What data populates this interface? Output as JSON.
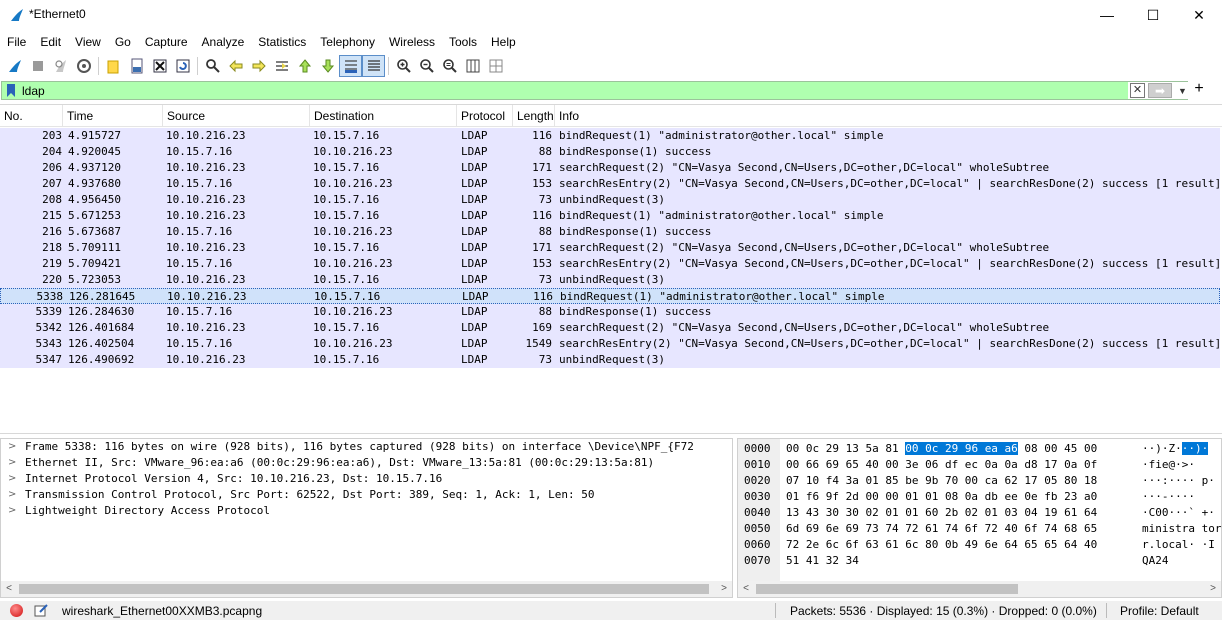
{
  "window": {
    "title": "*Ethernet0",
    "minimize": "—",
    "maximize": "☐",
    "close": "✕"
  },
  "menu": [
    "File",
    "Edit",
    "View",
    "Go",
    "Capture",
    "Analyze",
    "Statistics",
    "Telephony",
    "Wireless",
    "Tools",
    "Help"
  ],
  "filter": {
    "value": "ldap",
    "clear": "✕",
    "apply": "➡",
    "dropdown": "▼",
    "add": "+"
  },
  "columns": [
    "No.",
    "Time",
    "Source",
    "Destination",
    "Protocol",
    "Length",
    "Info"
  ],
  "packets": [
    {
      "no": "203",
      "time": "4.915727",
      "src": "10.10.216.23",
      "dst": "10.15.7.16",
      "proto": "LDAP",
      "len": "116",
      "info": "bindRequest(1) \"administrator@other.local\" simple"
    },
    {
      "no": "204",
      "time": "4.920045",
      "src": "10.15.7.16",
      "dst": "10.10.216.23",
      "proto": "LDAP",
      "len": "88",
      "info": "bindResponse(1) success"
    },
    {
      "no": "206",
      "time": "4.937120",
      "src": "10.10.216.23",
      "dst": "10.15.7.16",
      "proto": "LDAP",
      "len": "171",
      "info": "searchRequest(2) \"CN=Vasya Second,CN=Users,DC=other,DC=local\" wholeSubtree"
    },
    {
      "no": "207",
      "time": "4.937680",
      "src": "10.15.7.16",
      "dst": "10.10.216.23",
      "proto": "LDAP",
      "len": "153",
      "info": "searchResEntry(2) \"CN=Vasya Second,CN=Users,DC=other,DC=local\"  | searchResDone(2) success  [1 result]"
    },
    {
      "no": "208",
      "time": "4.956450",
      "src": "10.10.216.23",
      "dst": "10.15.7.16",
      "proto": "LDAP",
      "len": "73",
      "info": "unbindRequest(3)"
    },
    {
      "no": "215",
      "time": "5.671253",
      "src": "10.10.216.23",
      "dst": "10.15.7.16",
      "proto": "LDAP",
      "len": "116",
      "info": "bindRequest(1) \"administrator@other.local\" simple"
    },
    {
      "no": "216",
      "time": "5.673687",
      "src": "10.15.7.16",
      "dst": "10.10.216.23",
      "proto": "LDAP",
      "len": "88",
      "info": "bindResponse(1) success"
    },
    {
      "no": "218",
      "time": "5.709111",
      "src": "10.10.216.23",
      "dst": "10.15.7.16",
      "proto": "LDAP",
      "len": "171",
      "info": "searchRequest(2) \"CN=Vasya Second,CN=Users,DC=other,DC=local\" wholeSubtree"
    },
    {
      "no": "219",
      "time": "5.709421",
      "src": "10.15.7.16",
      "dst": "10.10.216.23",
      "proto": "LDAP",
      "len": "153",
      "info": "searchResEntry(2) \"CN=Vasya Second,CN=Users,DC=other,DC=local\"  | searchResDone(2) success  [1 result]"
    },
    {
      "no": "220",
      "time": "5.723053",
      "src": "10.10.216.23",
      "dst": "10.15.7.16",
      "proto": "LDAP",
      "len": "73",
      "info": "unbindRequest(3)"
    },
    {
      "no": "5338",
      "time": "126.281645",
      "src": "10.10.216.23",
      "dst": "10.15.7.16",
      "proto": "LDAP",
      "len": "116",
      "info": "bindRequest(1) \"administrator@other.local\" simple"
    },
    {
      "no": "5339",
      "time": "126.284630",
      "src": "10.15.7.16",
      "dst": "10.10.216.23",
      "proto": "LDAP",
      "len": "88",
      "info": "bindResponse(1) success"
    },
    {
      "no": "5342",
      "time": "126.401684",
      "src": "10.10.216.23",
      "dst": "10.15.7.16",
      "proto": "LDAP",
      "len": "169",
      "info": "searchRequest(2) \"CN=Vasya Second,CN=Users,DC=other,DC=local\" wholeSubtree"
    },
    {
      "no": "5343",
      "time": "126.402504",
      "src": "10.15.7.16",
      "dst": "10.10.216.23",
      "proto": "LDAP",
      "len": "1549",
      "info": "searchResEntry(2) \"CN=Vasya Second,CN=Users,DC=other,DC=local\"  | searchResDone(2) success  [1 result]"
    },
    {
      "no": "5347",
      "time": "126.490692",
      "src": "10.10.216.23",
      "dst": "10.15.7.16",
      "proto": "LDAP",
      "len": "73",
      "info": "unbindRequest(3)"
    }
  ],
  "details": [
    "Frame 5338: 116 bytes on wire (928 bits), 116 bytes captured (928 bits) on interface \\Device\\NPF_{F72",
    "Ethernet II, Src: VMware_96:ea:a6 (00:0c:29:96:ea:a6), Dst: VMware_13:5a:81 (00:0c:29:13:5a:81)",
    "Internet Protocol Version 4, Src: 10.10.216.23, Dst: 10.15.7.16",
    "Transmission Control Protocol, Src Port: 62522, Dst Port: 389, Seq: 1, Ack: 1, Len: 50",
    "Lightweight Directory Access Protocol"
  ],
  "bytes": [
    {
      "off": "0000",
      "hex_a": "00 0c 29 13 5a 81 ",
      "hex_hl": "00 0c  29 96 ea a6",
      "hex_b": " 08 00 45 00",
      "asc_a": "··)·Z·",
      "asc_hl": "··)·",
      "asc_b": ""
    },
    {
      "off": "0010",
      "hex_a": "00 66 69 65 40 00 3e 06  df ec 0a 0a d8 17 0a 0f",
      "hex_hl": "",
      "hex_b": "",
      "asc_a": "·fie@·>·",
      "asc_hl": "",
      "asc_b": ""
    },
    {
      "off": "0020",
      "hex_a": "07 10 f4 3a 01 85 be 9b  70 00 ca 62 17 05 80 18",
      "hex_hl": "",
      "hex_b": "",
      "asc_a": "···:····  p·",
      "asc_hl": "",
      "asc_b": ""
    },
    {
      "off": "0030",
      "hex_a": "01 f6 9f 2d 00 00 01 01  08 0a db ee 0e fb 23 a0",
      "hex_hl": "",
      "hex_b": "",
      "asc_a": "···-····",
      "asc_hl": "",
      "asc_b": ""
    },
    {
      "off": "0040",
      "hex_a": "13 43 30 30 02 01 01 60  2b 02 01 03 04 19 61 64",
      "hex_hl": "",
      "hex_b": "",
      "asc_a": "·C00···` +·",
      "asc_hl": "",
      "asc_b": ""
    },
    {
      "off": "0050",
      "hex_a": "6d 69 6e 69 73 74 72 61  74 6f 72 40 6f 74 68 65",
      "hex_hl": "",
      "hex_b": "",
      "asc_a": "ministra tor",
      "asc_hl": "",
      "asc_b": ""
    },
    {
      "off": "0060",
      "hex_a": "72 2e 6c 6f 63 61 6c 80  0b 49 6e 64 65 65 64 40",
      "hex_hl": "",
      "hex_b": "",
      "asc_a": "r.local· ·I",
      "asc_hl": "",
      "asc_b": ""
    },
    {
      "off": "0070",
      "hex_a": "51 41 32 34",
      "hex_hl": "",
      "hex_b": "",
      "asc_a": "QA24",
      "asc_hl": "",
      "asc_b": ""
    }
  ],
  "status": {
    "file": "wireshark_Ethernet00XXMB3.pcapng",
    "packets": "Packets: 5536 · Displayed: 15 (0.3%) · Dropped: 0 (0.0%)",
    "profile": "Profile: Default"
  },
  "colors": {
    "row_bg": "#e7e6ff",
    "row_selected": "#d0e2fa",
    "filter_ok": "#afffaf",
    "byte_highlight": "#0078d7"
  }
}
